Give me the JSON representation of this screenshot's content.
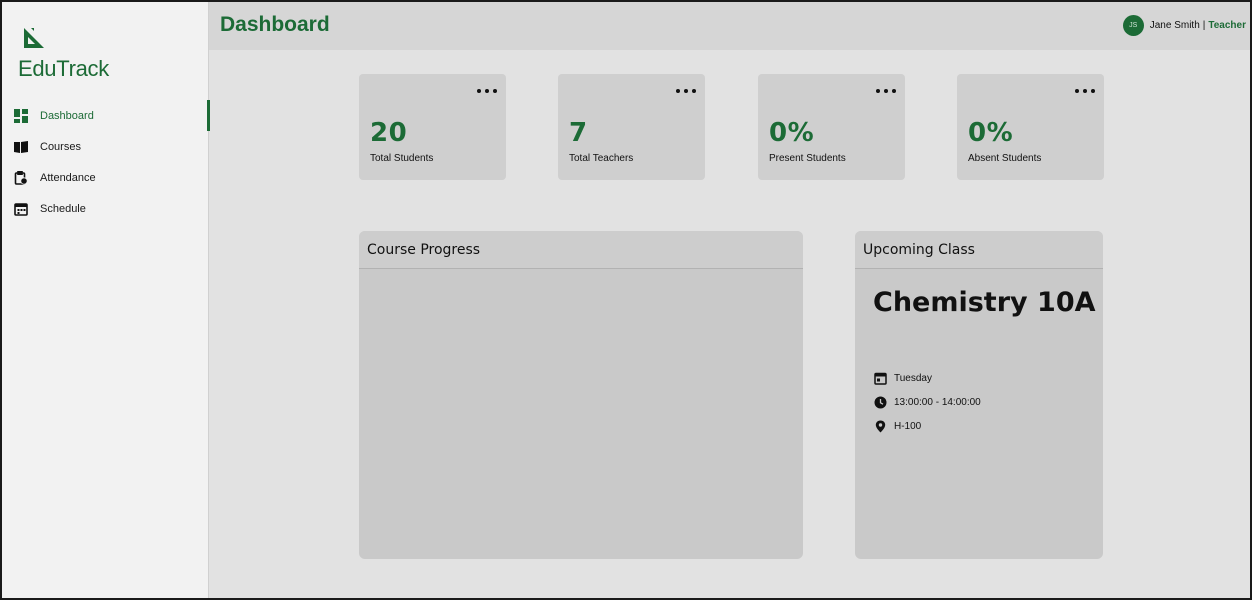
{
  "app": {
    "name": "EduTrack",
    "logo_icon": "set-square-icon"
  },
  "sidebar": {
    "items": [
      {
        "label": "Dashboard",
        "icon": "dashboard-icon",
        "active": true
      },
      {
        "label": "Courses",
        "icon": "book-icon",
        "active": false
      },
      {
        "label": "Attendance",
        "icon": "clipboard-clock-icon",
        "active": false
      },
      {
        "label": "Schedule",
        "icon": "calendar-icon",
        "active": false
      }
    ]
  },
  "header": {
    "title": "Dashboard",
    "user": {
      "initials": "JS",
      "name": "Jane Smith",
      "separator": "|",
      "role": "Teacher"
    }
  },
  "stats": [
    {
      "value": "20",
      "label": "Total Students"
    },
    {
      "value": "7",
      "label": "Total Teachers"
    },
    {
      "value": "0%",
      "label": "Present Students"
    },
    {
      "value": "0%",
      "label": "Absent Students"
    }
  ],
  "course_progress": {
    "title": "Course Progress"
  },
  "upcoming_class": {
    "title": "Upcoming Class",
    "name": "Chemistry 10A",
    "day": "Tuesday",
    "time": "13:00:00 - 14:00:00",
    "room": "H-100"
  },
  "colors": {
    "accent": "#1c6b36",
    "background": "#e2e2e2",
    "sidebar": "#f2f2f2",
    "card": "#cfcfcf"
  }
}
